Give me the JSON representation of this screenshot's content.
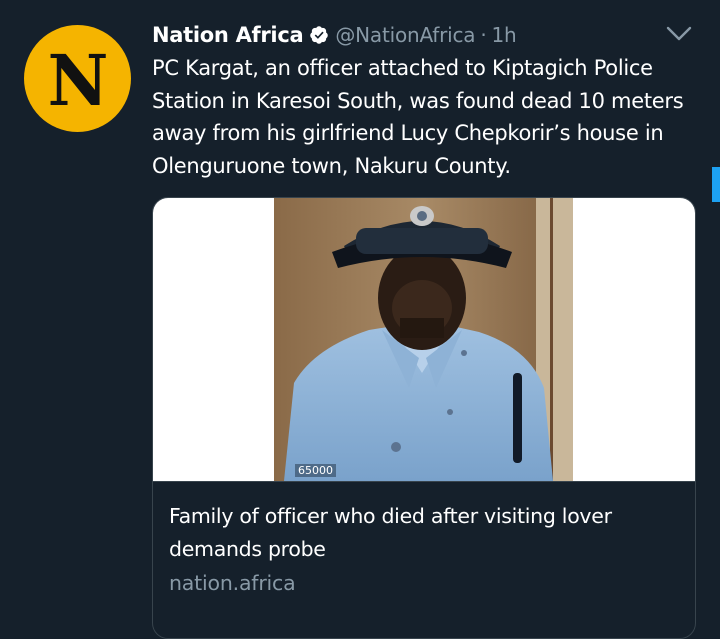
{
  "tweet": {
    "avatar_letter": "N",
    "display_name": "Nation Africa",
    "handle": "@NationAfrica",
    "separator": "·",
    "time": "1h",
    "text": "PC Kargat, an officer attached to Kiptagich Police Station in Karesoi South, was found dead 10 meters away from his girlfriend Lucy Chepkorir’s house in Olenguruone town, Nakuru County."
  },
  "card": {
    "photo_tag": "65000",
    "title": "Family of officer who died after visiting lover demands probe",
    "domain": "nation.africa"
  },
  "icons": {
    "verified": "verified-badge-icon",
    "more": "chevron-down-icon"
  },
  "colors": {
    "background": "#15202b",
    "secondary_text": "#8899a6",
    "avatar_bg": "#f5b400",
    "accent": "#1da1f2",
    "border": "#38444d"
  }
}
